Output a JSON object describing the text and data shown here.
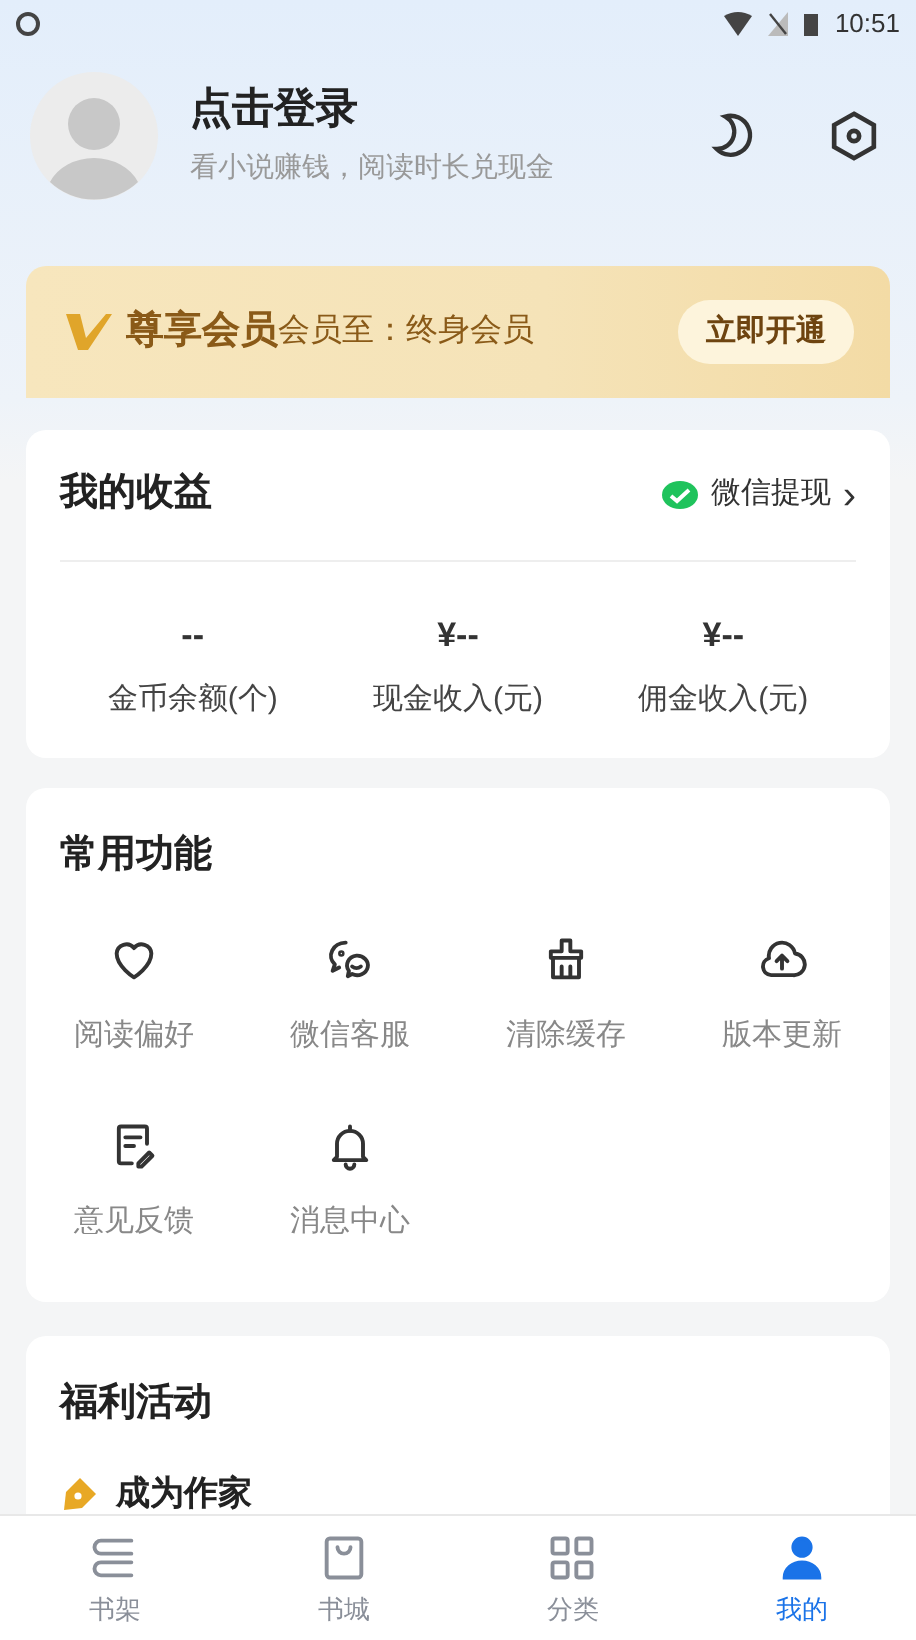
{
  "status_bar": {
    "time": "10:51"
  },
  "profile": {
    "title": "点击登录",
    "subtitle": "看小说赚钱，阅读时长兑现金"
  },
  "vip": {
    "badge": "尊享会员",
    "text": "会员至：终身会员",
    "button": "立即开通"
  },
  "earnings": {
    "title": "我的收益",
    "withdraw": "微信提现",
    "chevron": "›",
    "stats": [
      {
        "value": "--",
        "label": "金币余额(个)"
      },
      {
        "value": "¥--",
        "label": "现金收入(元)"
      },
      {
        "value": "¥--",
        "label": "佣金收入(元)"
      }
    ]
  },
  "functions": {
    "title": "常用功能",
    "items": [
      {
        "kind": "heart",
        "label": "阅读偏好"
      },
      {
        "kind": "chat",
        "label": "微信客服"
      },
      {
        "kind": "broom",
        "label": "清除缓存"
      },
      {
        "kind": "upload",
        "label": "版本更新"
      },
      {
        "kind": "feedback",
        "label": "意见反馈"
      },
      {
        "kind": "bell",
        "label": "消息中心"
      }
    ]
  },
  "welfare": {
    "title": "福利活动",
    "items": [
      {
        "title": "成为作家"
      }
    ]
  },
  "tabs": [
    {
      "kind": "shelf",
      "label": "书架",
      "selected": false
    },
    {
      "kind": "store",
      "label": "书城",
      "selected": false
    },
    {
      "kind": "grid",
      "label": "分类",
      "selected": false
    },
    {
      "kind": "me",
      "label": "我的",
      "selected": true
    }
  ]
}
